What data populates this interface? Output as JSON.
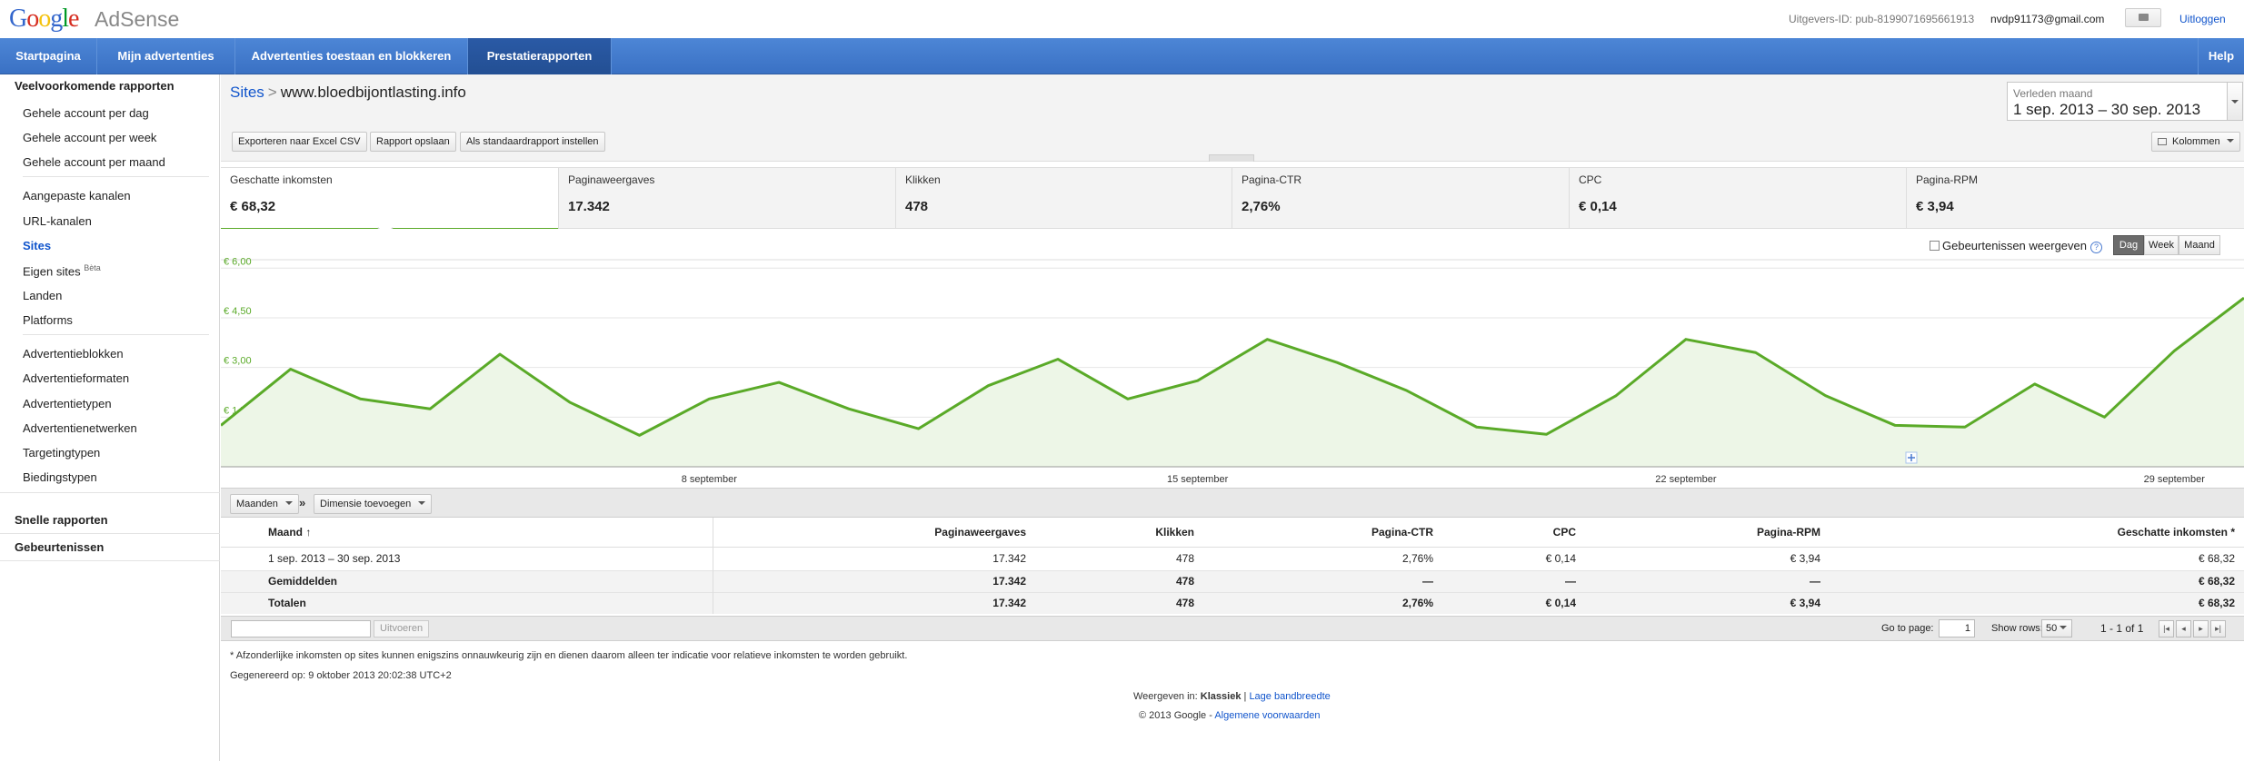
{
  "header": {
    "logo_text": "Google",
    "product": "AdSense",
    "publisher_id": "Uitgevers-ID: pub-8199071695661913",
    "email": "nvdp91173@gmail.com",
    "logout": "Uitloggen"
  },
  "nav": {
    "tabs": [
      {
        "label": "Startpagina"
      },
      {
        "label": "Mijn advertenties"
      },
      {
        "label": "Advertenties toestaan en blokkeren"
      },
      {
        "label": "Prestatierapporten"
      }
    ],
    "help": "Help"
  },
  "sidebar": {
    "common_heading": "Veelvoorkomende rapporten",
    "items": [
      {
        "label": "Gehele account per dag"
      },
      {
        "label": "Gehele account per week"
      },
      {
        "label": "Gehele account per maand"
      },
      {
        "label": "Aangepaste kanalen"
      },
      {
        "label": "URL-kanalen"
      },
      {
        "label": "Sites"
      },
      {
        "label": "Eigen sites",
        "badge": "Bèta"
      },
      {
        "label": "Landen"
      },
      {
        "label": "Platforms"
      },
      {
        "label": "Advertentieblokken"
      },
      {
        "label": "Advertentieformaten"
      },
      {
        "label": "Advertentietypen"
      },
      {
        "label": "Advertentienetwerken"
      },
      {
        "label": "Targetingtypen"
      },
      {
        "label": "Biedingstypen"
      }
    ],
    "quick_reports": "Snelle rapporten",
    "events": "Gebeurtenissen"
  },
  "report": {
    "breadcrumb_link": "Sites",
    "breadcrumb_sep": ">",
    "breadcrumb_current": "www.bloedbijontlasting.info",
    "buttons": {
      "export": "Exporteren naar Excel CSV",
      "save": "Rapport opslaan",
      "default": "Als standaardrapport instellen"
    },
    "date_range_label": "Verleden maand",
    "date_range_value": "1 sep. 2013 – 30 sep. 2013",
    "columns_button": "Kolommen"
  },
  "metrics": [
    {
      "label": "Geschatte inkomsten",
      "value": "€ 68,32"
    },
    {
      "label": "Paginaweergaves",
      "value": "17.342"
    },
    {
      "label": "Klikken",
      "value": "478"
    },
    {
      "label": "Pagina-CTR",
      "value": "2,76%"
    },
    {
      "label": "CPC",
      "value": "€ 0,14"
    },
    {
      "label": "Pagina-RPM",
      "value": "€ 3,94"
    }
  ],
  "chart_controls": {
    "events_toggle": "Gebeurtenissen weergeven",
    "help_icon": "?",
    "granularity": [
      "Dag",
      "Week",
      "Maand"
    ],
    "selected": "Dag"
  },
  "chart_data": {
    "type": "area",
    "series": [
      {
        "values": [
          1.25,
          2.95,
          2.05,
          1.75,
          3.4,
          1.95,
          0.95,
          2.05,
          2.55,
          1.75,
          1.15,
          2.45,
          3.25,
          2.05,
          2.6,
          3.85,
          3.15,
          2.3,
          1.2,
          0.98,
          2.15,
          3.85,
          3.45,
          2.15,
          1.25,
          1.2,
          2.5,
          1.5,
          3.5,
          5.1
        ]
      }
    ],
    "x": [
      "1 sep",
      "2 sep",
      "3 sep",
      "4 sep",
      "5 sep",
      "6 sep",
      "7 sep",
      "8 sep",
      "9 sep",
      "10 sep",
      "11 sep",
      "12 sep",
      "13 sep",
      "14 sep",
      "15 sep",
      "16 sep",
      "17 sep",
      "18 sep",
      "19 sep",
      "20 sep",
      "21 sep",
      "22 sep",
      "23 sep",
      "24 sep",
      "25 sep",
      "26 sep",
      "27 sep",
      "28 sep",
      "29 sep",
      "30 sep"
    ],
    "ytick_labels": [
      "€ 6,00",
      "€ 4,50",
      "€ 3,00",
      "€ 1,50"
    ],
    "yticks": [
      6.0,
      4.5,
      3.0,
      1.5
    ],
    "xtick_labels": [
      "8 september",
      "15 september",
      "22 september",
      "29 september"
    ],
    "xtick_index": [
      7,
      14,
      21,
      28
    ],
    "ylim": [
      0,
      6.2
    ],
    "color": "#5aaa28",
    "fill": "#edf6e7",
    "grid": true
  },
  "table_toolbar": {
    "dimension_select": "Maanden",
    "add_dimension": "Dimensie toevoegen",
    "separator": "»"
  },
  "table": {
    "headers": [
      "Maand",
      "Paginaweergaves",
      "Klikken",
      "Pagina-CTR",
      "CPC",
      "Pagina-RPM",
      "Geschatte inkomsten *"
    ],
    "sort_indicator": "↑",
    "rows": [
      [
        "1 sep. 2013 – 30 sep. 2013",
        "17.342",
        "478",
        "2,76%",
        "€ 0,14",
        "€ 3,94",
        "€ 68,32"
      ]
    ],
    "averages": [
      "Gemiddelden",
      "17.342",
      "478",
      "—",
      "—",
      "—",
      "€ 68,32"
    ],
    "totals": [
      "Totalen",
      "17.342",
      "478",
      "2,76%",
      "€ 0,14",
      "€ 3,94",
      "€ 68,32"
    ]
  },
  "pager": {
    "run_button": "Uitvoeren",
    "goto_label": "Go to page:",
    "goto_value": "1",
    "rows_label": "Show rows:",
    "rows_value": "50",
    "range": "1 - 1 of 1"
  },
  "footer": {
    "note": "* Afzonderlijke inkomsten op sites kunnen enigszins onnauwkeurig zijn en dienen daarom alleen ter indicatie voor relatieve inkomsten te worden gebruikt.",
    "generated": "Gegenereerd op: 9 oktober 2013 20:02:38 UTC+2",
    "view_label": "Weergeven in:",
    "view_current": "Klassiek",
    "view_sep": "|",
    "view_alt": "Lage bandbreedte",
    "copyright": "© 2013 Google -",
    "terms": "Algemene voorwaarden"
  }
}
